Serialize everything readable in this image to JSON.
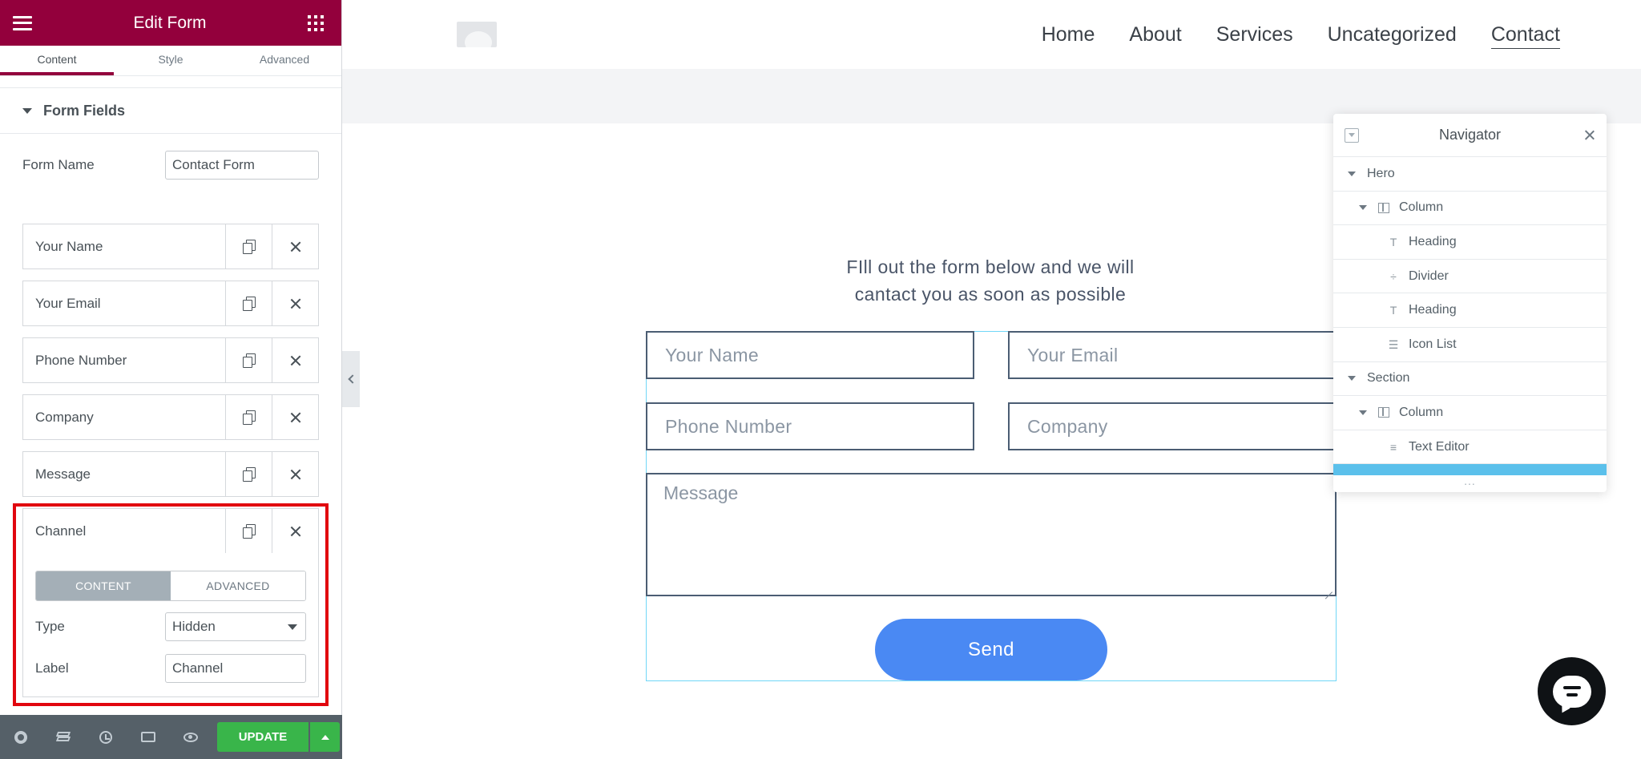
{
  "panel": {
    "title": "Edit Form",
    "tabs": [
      "Content",
      "Style",
      "Advanced"
    ],
    "section_title": "Form Fields",
    "form_name_label": "Form Name",
    "form_name_value": "Contact Form",
    "fields": [
      "Your Name",
      "Your Email",
      "Phone Number",
      "Company",
      "Message",
      "Channel"
    ],
    "channel": {
      "seg_content": "CONTENT",
      "seg_advanced": "ADVANCED",
      "type_label": "Type",
      "type_value": "Hidden",
      "label_label": "Label",
      "label_value": "Channel"
    },
    "footer": {
      "update_label": "UPDATE"
    }
  },
  "site": {
    "nav": [
      "Home",
      "About",
      "Services",
      "Uncategorized",
      "Contact"
    ],
    "intro_line1": "FIll out the form below and we will",
    "intro_line2": "cantact you as soon as possible",
    "form": {
      "name_placeholder": "Your Name",
      "email_placeholder": "Your Email",
      "phone_placeholder": "Phone Number",
      "company_placeholder": "Company",
      "message_placeholder": "Message",
      "send_label": "Send"
    }
  },
  "navigator": {
    "title": "Navigator",
    "items": [
      "Hero",
      "Column",
      "Heading",
      "Divider",
      "Heading",
      "Icon List",
      "Section",
      "Column",
      "Text Editor"
    ],
    "more": "..."
  },
  "colors": {
    "brand": "#93003c",
    "update_green": "#39b54a",
    "send_blue": "#4a89f3",
    "highlight_red": "#e1060e",
    "selection_blue": "#5bc0eb"
  }
}
